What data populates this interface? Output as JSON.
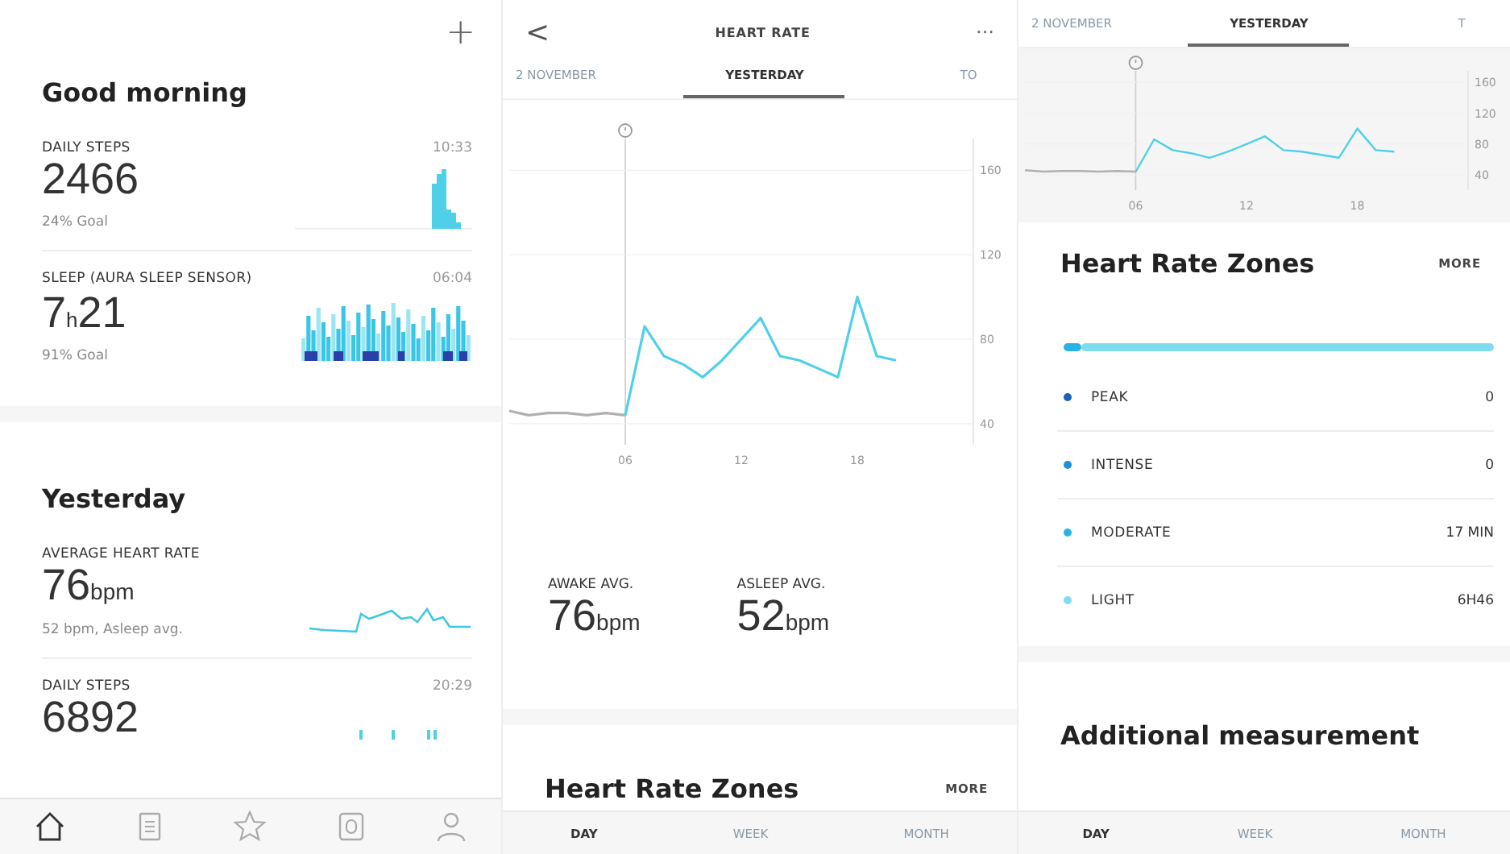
{
  "timeline": {
    "add_button": "+",
    "sections": [
      {
        "title": "Good morning",
        "cards": [
          {
            "kind": "steps",
            "title": "DAILY STEPS",
            "time": "10:33",
            "value": "2466",
            "note": "24% Goal"
          },
          {
            "kind": "sleep",
            "title": "SLEEP (AURA SLEEP SENSOR)",
            "time": "06:04",
            "value": "7",
            "unit": "h",
            "value_after": "21",
            "note": "91% Goal"
          }
        ]
      },
      {
        "title": "Yesterday",
        "cards": [
          {
            "kind": "heart",
            "title": "AVERAGE HEART RATE",
            "value": "76",
            "unit": "bpm",
            "note": "52 bpm, Asleep avg."
          },
          {
            "kind": "steps_small",
            "title": "DAILY STEPS",
            "time": "20:29",
            "value": "6892"
          }
        ]
      }
    ],
    "nav": [
      {
        "kind": "home",
        "selected": true
      },
      {
        "kind": "dashboard",
        "selected": false
      },
      {
        "kind": "programs",
        "selected": false
      },
      {
        "kind": "devices",
        "selected": false
      },
      {
        "kind": "profile",
        "selected": false
      }
    ]
  },
  "heart_rate": {
    "back_button": "<",
    "title": "HEART RATE",
    "more_button": "···",
    "date_tabs": [
      {
        "label": "2 NOVEMBER",
        "selected": false
      },
      {
        "label": "YESTERDAY",
        "selected": true
      },
      {
        "label": "TO",
        "selected": false
      }
    ],
    "chart_data": {
      "type": "line",
      "x": [
        0,
        1,
        2,
        3,
        4,
        5,
        6,
        7,
        8,
        9,
        10,
        11,
        12,
        13,
        14,
        15,
        16,
        17,
        18,
        19,
        20
      ],
      "series": [
        {
          "color": "#b0b0b0",
          "values": [
            46,
            44,
            45,
            45,
            44,
            45,
            44,
            null,
            null,
            null,
            null,
            null,
            null,
            null,
            null,
            null,
            null,
            null,
            null,
            null,
            null
          ]
        },
        {
          "color": "#4fd0e8",
          "values": [
            null,
            null,
            null,
            null,
            null,
            null,
            44,
            86,
            72,
            68,
            62,
            70,
            80,
            90,
            72,
            70,
            66,
            62,
            100,
            72,
            70
          ]
        }
      ],
      "xlim": [
        0,
        24
      ],
      "ylim": [
        30,
        175
      ],
      "grid": true,
      "ref_lines": [
        {
          "axis": "x",
          "value": 6
        }
      ],
      "xticks": [
        {
          "value": 6,
          "label": "06"
        },
        {
          "value": 12,
          "label": "12"
        },
        {
          "value": 18,
          "label": "18"
        }
      ],
      "yticks": [
        40,
        80,
        120,
        160
      ]
    },
    "stats": [
      {
        "label": "AWAKE AVG.",
        "value": "76",
        "unit": "bpm"
      },
      {
        "label": "ASLEEP AVG.",
        "value": "52",
        "unit": "bpm"
      }
    ],
    "zones_title": "Heart Rate Zones",
    "zones_more": "MORE",
    "period_tabs": [
      {
        "label": "DAY",
        "selected": true
      },
      {
        "label": "WEEK",
        "selected": false
      },
      {
        "label": "MONTH",
        "selected": false
      }
    ]
  },
  "heart_rate_scrolled": {
    "date_tabs": [
      {
        "label": "2 NOVEMBER",
        "selected": false
      },
      {
        "label": "YESTERDAY",
        "selected": true
      },
      {
        "label": "T",
        "selected": false
      }
    ],
    "chart_data": {
      "type": "line",
      "x": [
        0,
        1,
        2,
        3,
        4,
        5,
        6,
        7,
        8,
        9,
        10,
        11,
        12,
        13,
        14,
        15,
        16,
        17,
        18,
        19,
        20
      ],
      "series": [
        {
          "color": "#b0b0b0",
          "values": [
            46,
            44,
            45,
            45,
            44,
            45,
            44,
            null,
            null,
            null,
            null,
            null,
            null,
            null,
            null,
            null,
            null,
            null,
            null,
            null,
            null
          ]
        },
        {
          "color": "#4fd0e8",
          "values": [
            null,
            null,
            null,
            null,
            null,
            null,
            44,
            86,
            72,
            68,
            62,
            70,
            80,
            90,
            72,
            70,
            66,
            62,
            100,
            72,
            70
          ]
        }
      ],
      "xlim": [
        0,
        24
      ],
      "ylim": [
        20,
        175
      ],
      "grid": true,
      "ref_lines": [
        {
          "axis": "x",
          "value": 6
        }
      ],
      "xticks": [
        {
          "value": 6,
          "label": "06"
        },
        {
          "value": 12,
          "label": "12"
        },
        {
          "value": 18,
          "label": "18"
        }
      ],
      "yticks": [
        40,
        80,
        120,
        160
      ]
    },
    "zones_title": "Heart Rate Zones",
    "zones_more": "MORE",
    "zones": [
      {
        "label": "PEAK",
        "value": "0",
        "color": "#1a63b8",
        "level": 0
      },
      {
        "label": "INTENSE",
        "value": "0",
        "color": "#1f8fd8",
        "level": 0
      },
      {
        "label": "MODERATE",
        "value": "17 MIN",
        "color": "#27b3e3",
        "level": 0.04
      },
      {
        "label": "LIGHT",
        "value": "6H46",
        "color": "#7fdcef",
        "level": 0.96
      }
    ],
    "additional_title": "Additional measurement",
    "period_tabs": [
      {
        "label": "DAY",
        "selected": true
      },
      {
        "label": "WEEK",
        "selected": false
      },
      {
        "label": "MONTH",
        "selected": false
      }
    ]
  }
}
